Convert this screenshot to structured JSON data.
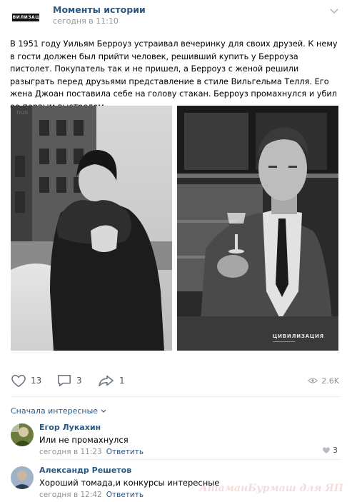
{
  "header": {
    "group_name": "Моменты истории",
    "time": "сегодня в 11:10",
    "logo_text": "ЦИВИЛИЗАЦИЯ"
  },
  "post": {
    "text": "В 1951 году Уильям Берроуз устраивал вечеринку для своих друзей. К нему в гости должен был прийти человек, решивший купить у Берроуза пистолет. Покупатель так и не пришел, а Берроуз с женой решили разыграть перед друзьями представление в стиле Вильгельма Телля. Его жена Джоан поставила себе на голову стакан. Берроуз промахнулся и убил ее первым выстрелом"
  },
  "photos": {
    "badge_title": "ЦИВИЛИЗАЦИЯ"
  },
  "actions": {
    "likes": "13",
    "comments": "3",
    "shares": "1",
    "views": "2.6K"
  },
  "comments_sort": "Сначала интересные",
  "comments": [
    {
      "author": "Егор Лукахин",
      "text": "Или не промахнулся",
      "time": "сегодня в 11:23",
      "reply": "Ответить",
      "likes": "3"
    },
    {
      "author": "Александр Решетов",
      "text": "Хороший томада,и конкурсы интересные",
      "time": "сегодня в 12:42",
      "reply": "Ответить"
    }
  ],
  "watermark": "АтаманБурмаш для ЯП",
  "colors": {
    "link": "#2a5885",
    "meta": "#939393",
    "divider": "#e7e8ec"
  }
}
